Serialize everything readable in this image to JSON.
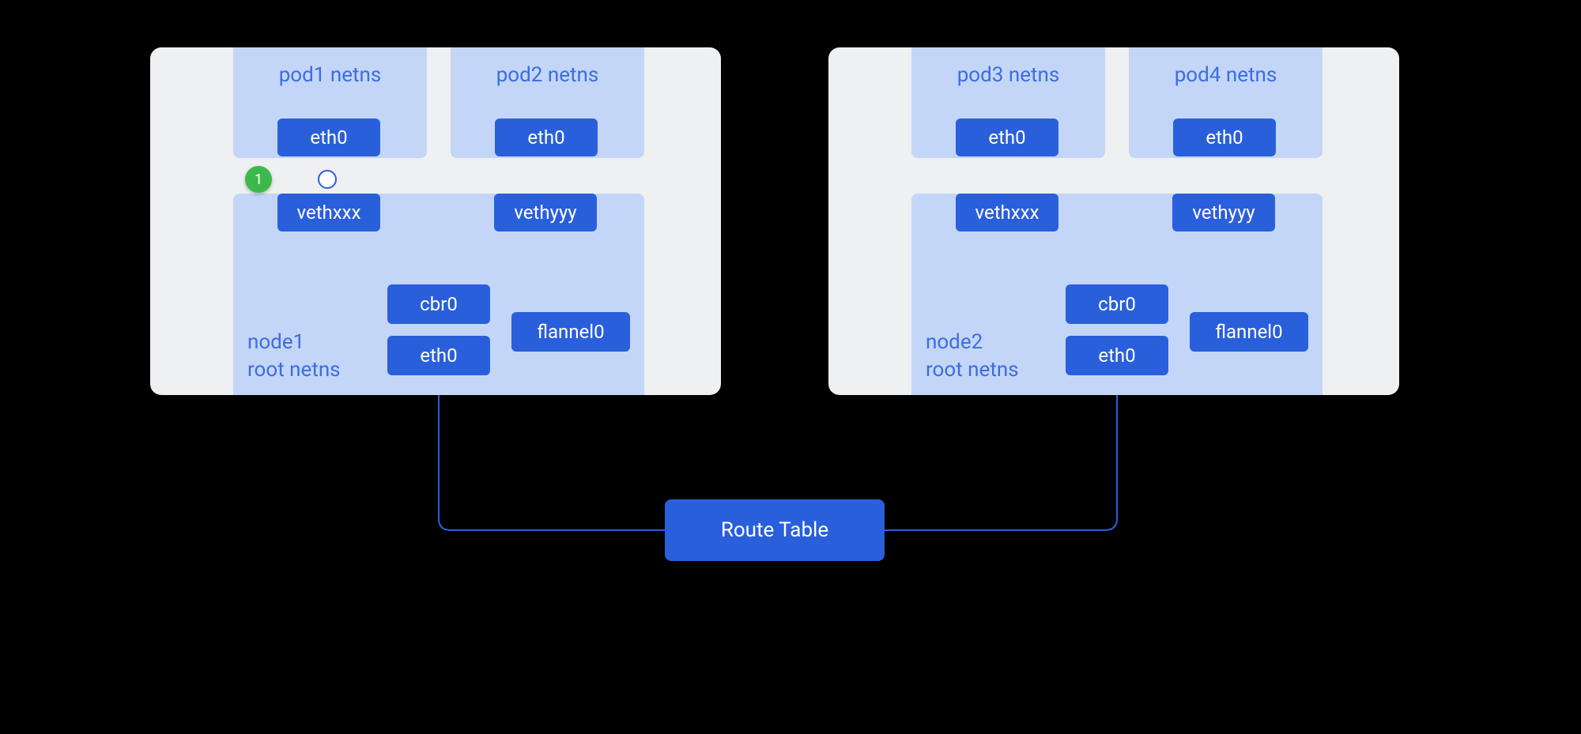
{
  "colors": {
    "box": "#2a5fdc",
    "panel": "#c4d6f7",
    "card": "#eef0f1",
    "text_accent": "#3b6de3",
    "badge": "#3cb94a",
    "bg": "#000000"
  },
  "nodes": [
    {
      "id": "node1",
      "root_label_line1": "node1",
      "root_label_line2": "root netns",
      "pods": [
        {
          "id": "pod1",
          "title": "pod1 netns",
          "eth": "eth0",
          "veth": "vethxxx"
        },
        {
          "id": "pod2",
          "title": "pod2 netns",
          "eth": "eth0",
          "veth": "vethyyy"
        }
      ],
      "cbr": "cbr0",
      "flannel": "flannel0",
      "eth_root": "eth0"
    },
    {
      "id": "node2",
      "root_label_line1": "node2",
      "root_label_line2": "root netns",
      "pods": [
        {
          "id": "pod3",
          "title": "pod3 netns",
          "eth": "eth0",
          "veth": "vethxxx"
        },
        {
          "id": "pod4",
          "title": "pod4 netns",
          "eth": "eth0",
          "veth": "vethyyy"
        }
      ],
      "cbr": "cbr0",
      "flannel": "flannel0",
      "eth_root": "eth0"
    }
  ],
  "route_table": "Route Table",
  "badge_1": "1"
}
